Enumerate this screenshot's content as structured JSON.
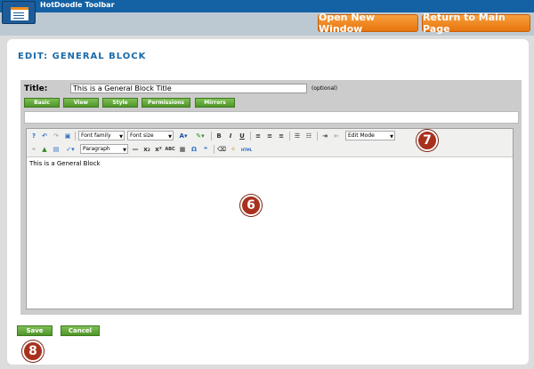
{
  "app": {
    "toolbar_title": "HotDoodle Toolbar",
    "open_new_window": "Open New Window",
    "return_main": "Return to Main Page"
  },
  "page": {
    "title": "EDIT: GENERAL BLOCK"
  },
  "form": {
    "title_label": "Title:",
    "title_value": "This is a General Block Title",
    "optional_label": "(optional)"
  },
  "tabs": [
    "Basic",
    "View",
    "Style",
    "Permissions",
    "Mirrors"
  ],
  "editor": {
    "font_family": "Font family",
    "font_size": "Font size",
    "format": "Paragraph",
    "mode": "Edit Mode",
    "content": "This is a General Block"
  },
  "buttons": {
    "save": "Save",
    "cancel": "Cancel"
  },
  "callouts": {
    "editor_area": "6",
    "toolbar": "7",
    "save": "8"
  },
  "colors": {
    "accent_blue": "#1461a4",
    "orange": "#e8740e",
    "green": "#4f9628",
    "callout": "#a8311e"
  }
}
